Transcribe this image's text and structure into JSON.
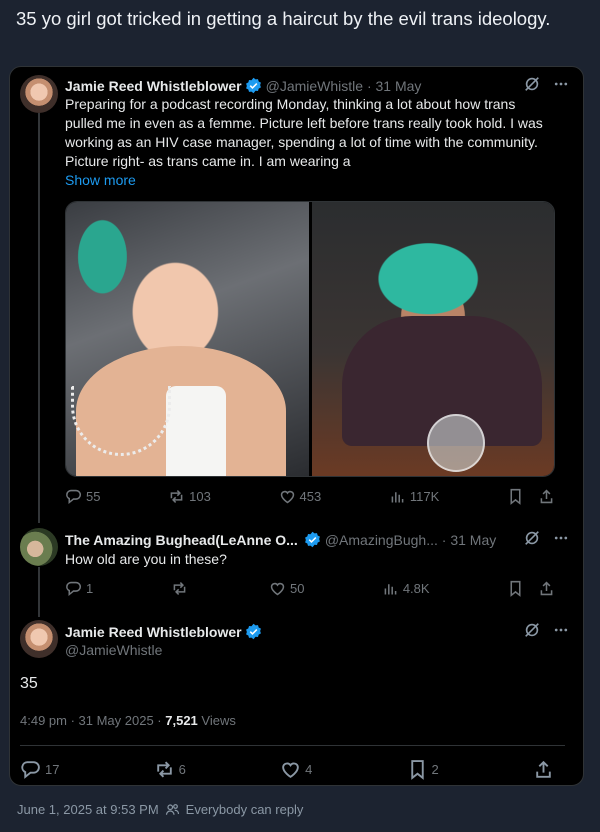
{
  "post": {
    "text": "35 yo girl got tricked in getting a haircut by the evil trans ideology."
  },
  "tweet1": {
    "name": "Jamie Reed Whistleblower",
    "handle": "@JamieWhistle",
    "dot_date": "· 31 May",
    "text": "Preparing for a podcast recording Monday, thinking a lot about how trans pulled me in even as a femme. Picture left before trans really took hold. I was working as an HIV case manager, spending a lot of time with the community. Picture right- as trans came in. I am wearing a",
    "show_more": "Show more",
    "replies": "55",
    "reposts": "103",
    "likes": "453",
    "views": "117K"
  },
  "tweet2": {
    "name": "The Amazing Bughead(LeAnne O...",
    "handle": "@AmazingBugh...",
    "dot_date": "· 31 May",
    "text": "How old are you in these?",
    "replies": "1",
    "reposts": "",
    "likes": "50",
    "views": "4.8K"
  },
  "tweet3": {
    "name": "Jamie Reed Whistleblower",
    "handle": "@JamieWhistle",
    "text": "35",
    "time": "4:49 pm · 31 May 2025 · ",
    "views_count": "7,521",
    "views_label": " Views",
    "replies": "17",
    "reposts": "6",
    "likes": "4",
    "bookmarks": "2"
  },
  "footer": {
    "date": "June 1, 2025 at 9:53 PM",
    "reply_setting": "Everybody can reply"
  },
  "colors": {
    "background": "#1c2330",
    "card": "#000000",
    "link": "#1d9bf0",
    "verified": "#1d9bf0",
    "muted": "#71767b"
  }
}
